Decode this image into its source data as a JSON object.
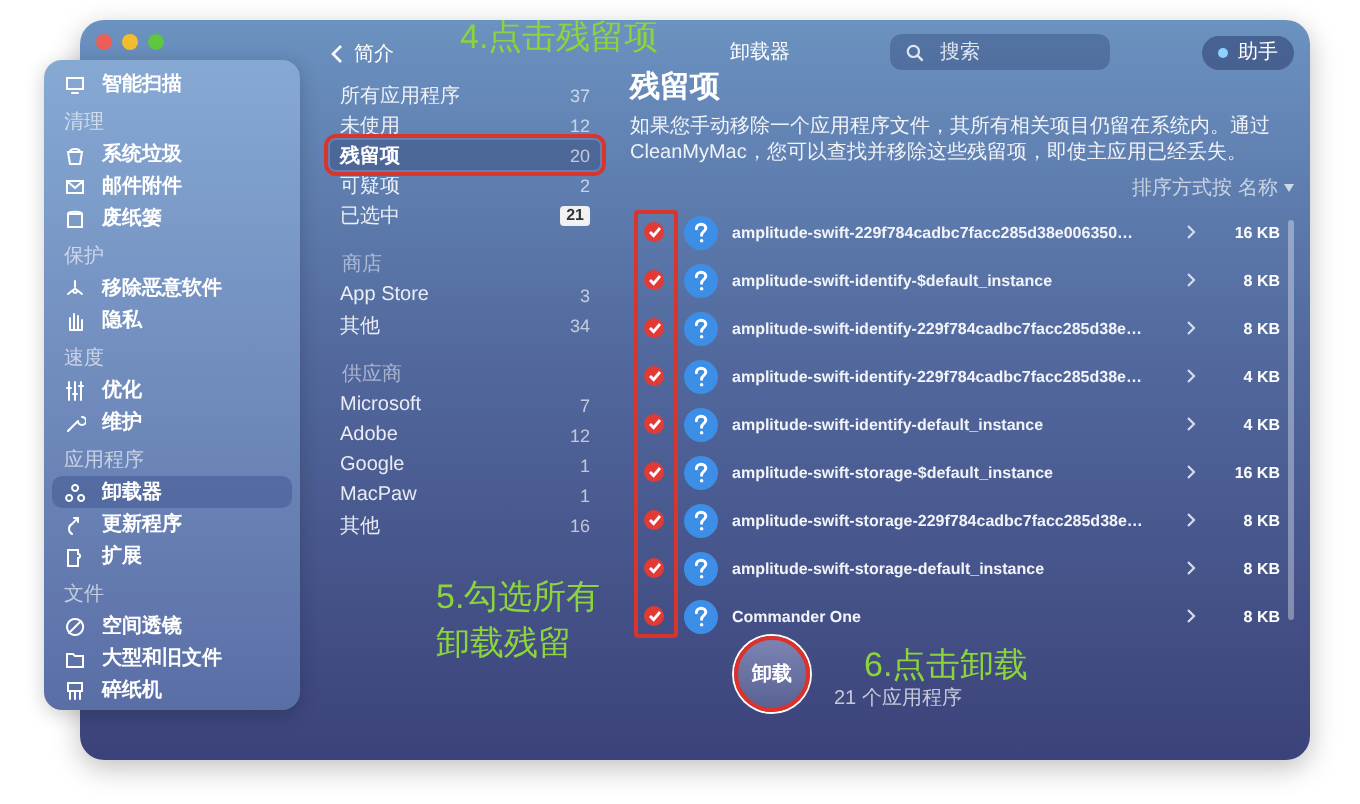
{
  "window": {
    "title": "卸载器"
  },
  "sidebar": {
    "sections": [
      {
        "items": [
          {
            "label": "智能扫描",
            "selected": false
          }
        ]
      },
      {
        "heading": "清理",
        "items": [
          {
            "label": "系统垃圾",
            "selected": false
          },
          {
            "label": "邮件附件",
            "selected": false
          },
          {
            "label": "废纸篓",
            "selected": false
          }
        ]
      },
      {
        "heading": "保护",
        "items": [
          {
            "label": "移除恶意软件",
            "selected": false
          },
          {
            "label": "隐私",
            "selected": false
          }
        ]
      },
      {
        "heading": "速度",
        "items": [
          {
            "label": "优化",
            "selected": false
          },
          {
            "label": "维护",
            "selected": false
          }
        ]
      },
      {
        "heading": "应用程序",
        "items": [
          {
            "label": "卸载器",
            "selected": true
          },
          {
            "label": "更新程序",
            "selected": false
          },
          {
            "label": "扩展",
            "selected": false
          }
        ]
      },
      {
        "heading": "文件",
        "items": [
          {
            "label": "空间透镜",
            "selected": false
          },
          {
            "label": "大型和旧文件",
            "selected": false
          },
          {
            "label": "碎纸机",
            "selected": false
          }
        ]
      }
    ]
  },
  "filters": {
    "back_link": "简介",
    "sections": [
      {
        "items": [
          {
            "label": "所有应用程序",
            "count": "37",
            "kind": "count",
            "selected": false,
            "highlighted": false
          },
          {
            "label": "未使用",
            "count": "12",
            "kind": "count",
            "selected": false,
            "highlighted": false
          },
          {
            "label": "残留项",
            "count": "20",
            "kind": "count",
            "selected": true,
            "highlighted": true
          },
          {
            "label": "可疑项",
            "count": "2",
            "kind": "count",
            "selected": false,
            "highlighted": false
          },
          {
            "label": "已选中",
            "count": "21",
            "kind": "badge",
            "selected": false,
            "highlighted": false
          }
        ]
      },
      {
        "heading": "商店",
        "items": [
          {
            "label": "App Store",
            "count": "3",
            "kind": "count",
            "selected": false,
            "highlighted": false
          },
          {
            "label": "其他",
            "count": "34",
            "kind": "count",
            "selected": false,
            "highlighted": false
          }
        ]
      },
      {
        "heading": "供应商",
        "items": [
          {
            "label": "Microsoft",
            "count": "7",
            "kind": "count",
            "selected": false,
            "highlighted": false
          },
          {
            "label": "Adobe",
            "count": "12",
            "kind": "count",
            "selected": false,
            "highlighted": false
          },
          {
            "label": "Google",
            "count": "1",
            "kind": "count",
            "selected": false,
            "highlighted": false
          },
          {
            "label": "MacPaw",
            "count": "1",
            "kind": "count",
            "selected": false,
            "highlighted": false
          },
          {
            "label": "其他",
            "count": "16",
            "kind": "count",
            "selected": false,
            "highlighted": false
          }
        ]
      }
    ]
  },
  "search": {
    "placeholder": "搜索"
  },
  "assistant": {
    "label": "助手"
  },
  "content": {
    "heading": "残留项",
    "description": "如果您手动移除一个应用程序文件，其所有相关项目仍留在系统内。通过 CleanMyMac，您可以查找并移除这些残留项，即使主应用已经丢失。",
    "sort": {
      "label": "排序方式按",
      "value": "名称"
    },
    "checkbox_column_highlighted": true,
    "rows": [
      {
        "name": "amplitude-swift-229f784cadbc7facc285d38e006350…",
        "size": "16 KB",
        "checked": true
      },
      {
        "name": "amplitude-swift-identify-$default_instance",
        "size": "8 KB",
        "checked": true
      },
      {
        "name": "amplitude-swift-identify-229f784cadbc7facc285d38e…",
        "size": "8 KB",
        "checked": true
      },
      {
        "name": "amplitude-swift-identify-229f784cadbc7facc285d38e…",
        "size": "4 KB",
        "checked": true
      },
      {
        "name": "amplitude-swift-identify-default_instance",
        "size": "4 KB",
        "checked": true
      },
      {
        "name": "amplitude-swift-storage-$default_instance",
        "size": "16 KB",
        "checked": true
      },
      {
        "name": "amplitude-swift-storage-229f784cadbc7facc285d38e…",
        "size": "8 KB",
        "checked": true
      },
      {
        "name": "amplitude-swift-storage-default_instance",
        "size": "8 KB",
        "checked": true
      },
      {
        "name": "Commander One",
        "size": "8 KB",
        "checked": true
      }
    ]
  },
  "uninstall_button": {
    "label": "卸载",
    "highlighted": true
  },
  "summary": "21 个应用程序",
  "annotations": [
    {
      "text": "4.点击残留项"
    },
    {
      "text": "5.勾选所有"
    },
    {
      "text": "卸载残留"
    },
    {
      "text": "6.点击卸载"
    }
  ]
}
